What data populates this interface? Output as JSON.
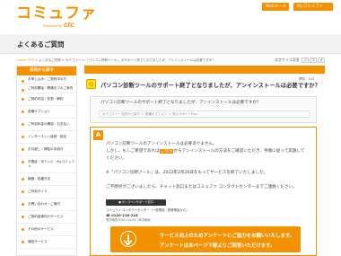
{
  "header": {
    "logo_text": "コミュファ",
    "logo_sub": "Powered by",
    "logo_brand": "ctc",
    "btn_web": "Webメール",
    "btn_my": "Myコミュファ"
  },
  "page_title": "よくあるご質問",
  "breadcrumb": {
    "home": "comm TOP",
    "path": " > よくあるご質問 > カテゴリー > 「パソコン診断ツール」 のサポート終了となりましたが、アンインストールは必要ですか？"
  },
  "font_size": {
    "label": "文字サイズ変更",
    "small": "小",
    "medium": "中",
    "large": "大"
  },
  "sidebar": {
    "head": "目的から探す",
    "items": [
      "お申し込み・ご契約中の方",
      "ご利用開始・開通までのご案内",
      "ご契約内容・変更・解約",
      "各種オプション",
      "ご利用料金の確認・お支払い",
      "インターネット接続・設定",
      "お引越し・移転の手続き",
      "光電話・光テレビ・Myコミュファ",
      "機器・各種方法",
      "ご利用ガイド",
      "お問い合わせ・ご案内",
      "ご契約者様向けサービス",
      "その他のサービス",
      "通信サービス"
    ]
  },
  "back_label": "◀ 戻る",
  "pv": "閲覧：443",
  "question": {
    "badge": "Q",
    "title": "パソコン診断ツールのサポート終了となりましたが、アンインストールは必要ですか？",
    "body": "パソコン診断ツールのサポート終了となりましたが、アンインストールは必要ですか？",
    "category": "カテゴリー：目的から探す ＞ 各種オプション ＞ 安心サポートPlus"
  },
  "answer": {
    "badge": "A",
    "line1": "パソコン診断ツールのアンインストールは必要ありません。",
    "line2a": "しかし、もしご希望であれば",
    "line2_link": "こちら",
    "line2b": "からアンインストールの方法をご確認いただき、手順に従って実施して",
    "line3": "ください。",
    "line4": "※「パソコン診断ツール」は、2022年2月28日をもってサービスを終了いたしました。",
    "line5": "ご不明点がございましたら、チャット窓口またはコミュファ コンタクトセンターまでご連絡ください。",
    "support_btn": "オンラインサポート窓口",
    "support_l1": "コミュファ コンタクトセンター（一般電話・携帯電話から）",
    "support_l2": "0120-218-218",
    "support_l3": "受付時間 9:00〜20:00（年中無休）"
  },
  "banner": {
    "line1": "サービス向上のためアンケートにご協力をお願いいたします。",
    "line2": "アンケートは本ページ下部よりご回答いただけます。"
  }
}
